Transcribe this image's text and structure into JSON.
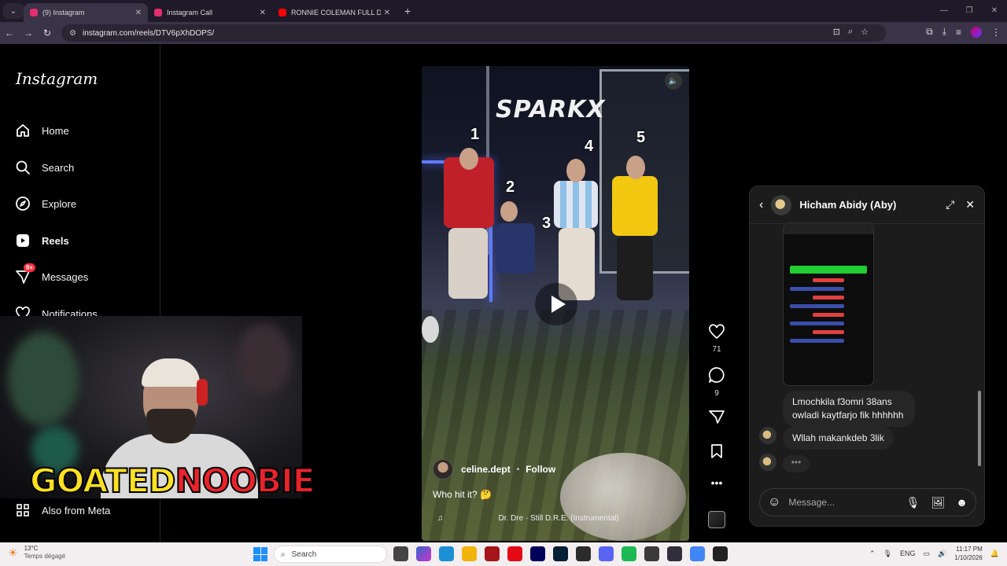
{
  "browser": {
    "tabs": [
      {
        "title": "(9) Instagram",
        "favicon_color": "#e1306c",
        "active": true
      },
      {
        "title": "Instagram Call",
        "favicon_color": "#e1306c",
        "active": false
      },
      {
        "title": "RONNIE COLEMAN FULL DAY C",
        "favicon_color": "#ff0000",
        "active": false
      }
    ],
    "url": "instagram.com/reels/DTV6pXhDOPS/"
  },
  "sidebar": {
    "logo": "Instagram",
    "items": [
      {
        "label": "Home",
        "icon": "home-icon"
      },
      {
        "label": "Search",
        "icon": "search-icon"
      },
      {
        "label": "Explore",
        "icon": "compass-icon"
      },
      {
        "label": "Reels",
        "icon": "reels-icon"
      },
      {
        "label": "Messages",
        "icon": "messenger-icon",
        "badge": "9+"
      },
      {
        "label": "Notifications",
        "icon": "heart-icon"
      }
    ],
    "also_from_meta": "Also from Meta"
  },
  "overlay": {
    "brand_left": "GOATED",
    "brand_right": "NOOBIE"
  },
  "reel": {
    "sign": "SPARKX",
    "numbers": [
      "1",
      "2",
      "3",
      "4",
      "5"
    ],
    "username": "celine.dept",
    "follow_label": "Follow",
    "caption": "Who hit it? 🤔",
    "audio_track": "Dr. Dre · Still D.R.E. (Instrumental)",
    "likes": "71",
    "comments": "9"
  },
  "chat": {
    "name": "Hicham Abidy (Aby)",
    "messages": [
      {
        "text": "Lmochkila f3omri 38ans owladi kaytfarjo fik hhhhhh"
      },
      {
        "text": "Wllah makankdeb 3lik"
      }
    ],
    "typing": "•••",
    "composer_placeholder": "Message..."
  },
  "taskbar": {
    "temperature": "13°C",
    "weather": "Temps dégagé",
    "search": "Search",
    "language": "ENG",
    "time": "11:17 PM",
    "date": "1/10/2026"
  },
  "colors": {
    "accent": "#0095f6",
    "badge": "#ff3040",
    "brand_yellow": "#ffe022",
    "brand_red": "#e8232c"
  }
}
